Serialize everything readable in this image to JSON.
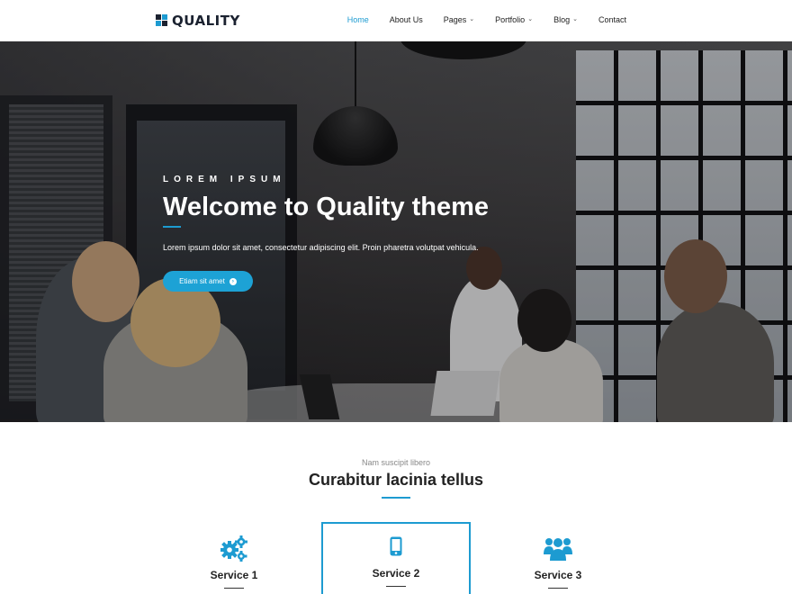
{
  "brand": {
    "name": "QUALITY",
    "accent": "#1d9bd1",
    "logo_icon": "grid-logo-icon"
  },
  "nav": {
    "items": [
      {
        "label": "Home",
        "active": true,
        "has_dropdown": false
      },
      {
        "label": "About Us",
        "active": false,
        "has_dropdown": false
      },
      {
        "label": "Pages",
        "active": false,
        "has_dropdown": true
      },
      {
        "label": "Portfolio",
        "active": false,
        "has_dropdown": true
      },
      {
        "label": "Blog",
        "active": false,
        "has_dropdown": true
      },
      {
        "label": "Contact",
        "active": false,
        "has_dropdown": false
      }
    ],
    "dropdown_icon": "chevron-down-icon"
  },
  "hero": {
    "eyebrow": "LOREM IPSUM",
    "title": "Welcome to Quality theme",
    "text": "Lorem ipsum dolor sit amet, consectetur adipiscing elit. Proin pharetra volutpat vehicula.",
    "button_label": "Etiam sit amet",
    "button_icon": "chevron-right-circle-icon",
    "image": "office-meeting-photo"
  },
  "services_section": {
    "subtitle": "Nam suscipit libero",
    "title_pre": "Curabitur ",
    "title_bold": "lacinia",
    "title_post": " tellus",
    "items": [
      {
        "title": "Service 1",
        "icon": "gears-icon",
        "highlighted": false
      },
      {
        "title": "Service 2",
        "icon": "mobile-phone-icon",
        "highlighted": true
      },
      {
        "title": "Service 3",
        "icon": "users-group-icon",
        "highlighted": false
      }
    ]
  }
}
